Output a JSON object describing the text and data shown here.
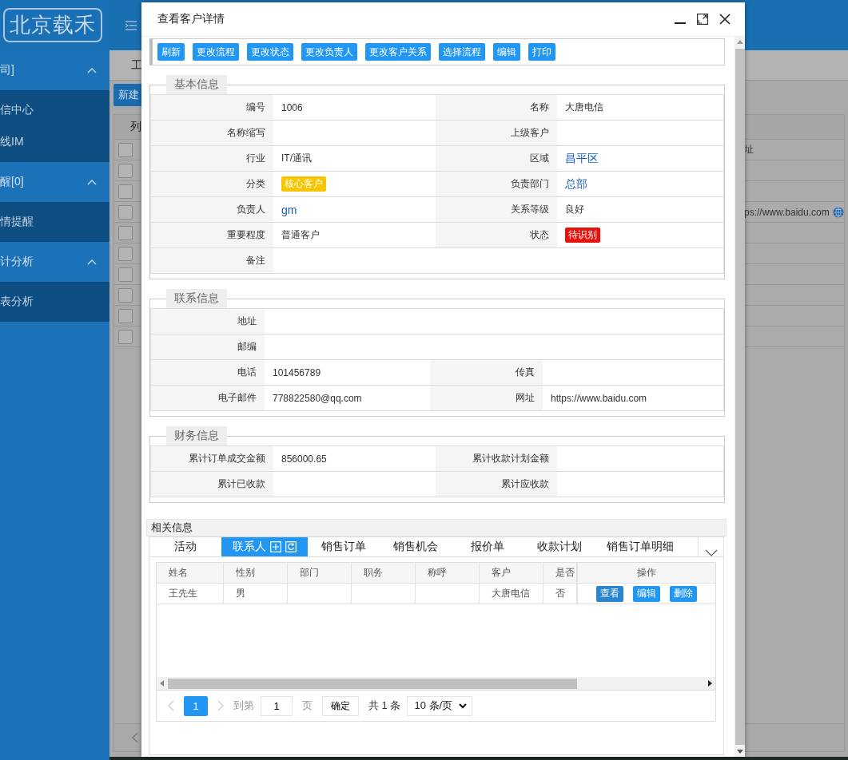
{
  "sidebar": {
    "logo": "北京载禾",
    "groups": [
      {
        "label": "司]",
        "expanded": true,
        "items": [
          {
            "label": "信中心"
          },
          {
            "label": "线IM"
          }
        ]
      },
      {
        "label": "醒[0]",
        "expanded": true,
        "items": [
          {
            "label": "情提醒"
          }
        ]
      },
      {
        "label": "计分析",
        "expanded": true,
        "items": [
          {
            "label": "表分析"
          }
        ]
      }
    ]
  },
  "main": {
    "tab": "工",
    "new_button": "新建",
    "column_header": "列",
    "right_header": "址",
    "header_checked": false,
    "rows": [
      {
        "checked": false
      },
      {
        "checked": false
      },
      {
        "checked": false,
        "website": "ps://www.baidu.com"
      },
      {
        "checked": false
      },
      {
        "checked": false
      },
      {
        "checked": false
      },
      {
        "checked": false
      },
      {
        "checked": false
      },
      {
        "checked": false
      }
    ]
  },
  "dialog": {
    "title": "查看客户详情",
    "toolbar": [
      "刷新",
      "更改流程",
      "更改状态",
      "更改负责人",
      "更改客户关系",
      "选择流程",
      "编辑",
      "打印"
    ],
    "sections": [
      {
        "legend": "基本信息",
        "rows": [
          [
            {
              "label": "编号",
              "value": "1006",
              "kind": "text"
            },
            {
              "label": "名称",
              "value": "大唐电信",
              "kind": "text"
            }
          ],
          [
            {
              "label": "名称缩写"
            },
            {
              "label": "上级客户"
            }
          ],
          [
            {
              "label": "行业",
              "value": "IT/通讯",
              "kind": "text"
            },
            {
              "label": "区域",
              "value": "昌平区",
              "kind": "link"
            }
          ],
          [
            {
              "label": "分类",
              "value": "核心客户",
              "kind": "badge",
              "color": "#f7c600"
            },
            {
              "label": "负责部门",
              "value": "总部",
              "kind": "link"
            }
          ],
          [
            {
              "label": "负责人",
              "value": "gm",
              "kind": "link"
            },
            {
              "label": "关系等级",
              "value": "良好",
              "kind": "text"
            }
          ],
          [
            {
              "label": "重要程度",
              "value": "普通客户",
              "kind": "text"
            },
            {
              "label": "状态",
              "value": "待识别",
              "kind": "badge",
              "color": "#e8120c"
            }
          ],
          [
            {
              "label": "备注"
            }
          ]
        ]
      },
      {
        "legend": "联系信息",
        "rows": [
          [
            {
              "label": "地址"
            }
          ],
          [
            {
              "label": "邮编"
            }
          ],
          [
            {
              "label": "电话",
              "value": "101456789",
              "kind": "text"
            },
            {
              "label": "传真"
            }
          ],
          [
            {
              "label": "电子邮件",
              "value": "778822580@qq.com",
              "kind": "text"
            },
            {
              "label": "网址",
              "value": "https://www.baidu.com",
              "kind": "text"
            }
          ]
        ]
      },
      {
        "legend": "财务信息",
        "rows": [
          [
            {
              "label": "累计订单成交金额",
              "value": "856000.65",
              "kind": "text"
            },
            {
              "label": "累计收款计划金额"
            }
          ],
          [
            {
              "label": "累计已收款"
            },
            {
              "label": "累计应收款"
            }
          ]
        ]
      }
    ],
    "related": {
      "title": "相关信息",
      "tabs": [
        {
          "label": "活动",
          "selected": false
        },
        {
          "label": "联系人",
          "selected": true
        },
        {
          "label": "销售订单",
          "selected": false
        },
        {
          "label": "销售机会",
          "selected": false
        },
        {
          "label": "报价单",
          "selected": false
        },
        {
          "label": "收款计划",
          "selected": false
        },
        {
          "label": "销售订单明细",
          "selected": false
        }
      ],
      "columns": [
        "姓名",
        "性别",
        "部门",
        "职务",
        "称呼",
        "客户",
        "是否"
      ],
      "action_column": "操作",
      "rows": [
        {
          "name": "王先生",
          "gender": "男",
          "customer": "大唐电信",
          "primary": "否",
          "actions": [
            "查看",
            "编辑",
            "删除"
          ]
        }
      ],
      "pagination": {
        "current_page": "1",
        "goto_label": "到第",
        "goto_value": "1",
        "page_label": "页",
        "confirm": "确定",
        "total": "共 1 条",
        "page_size": "10 条/页"
      }
    }
  }
}
